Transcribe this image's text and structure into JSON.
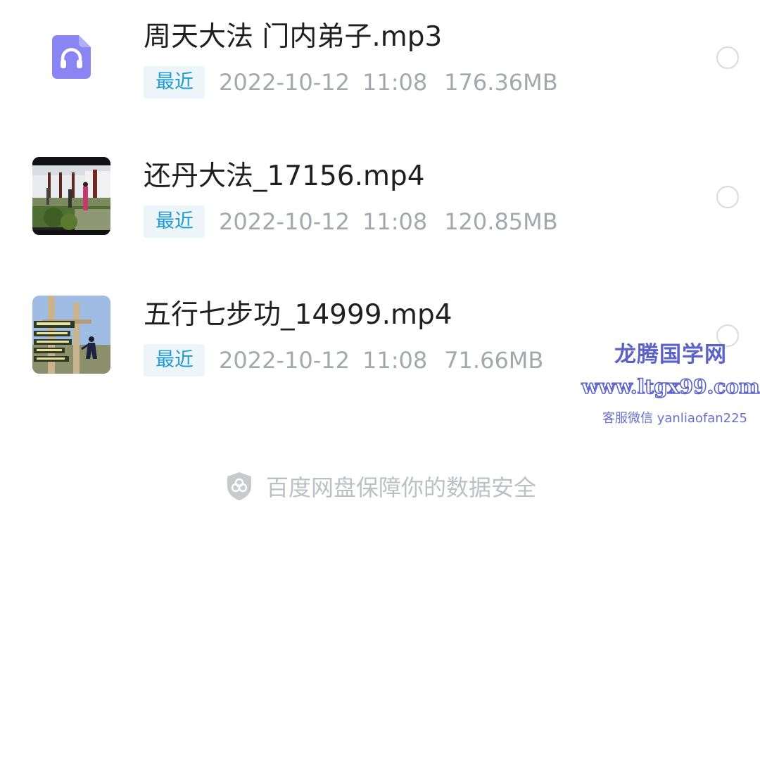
{
  "files": [
    {
      "name": "周天大法 门内弟子.mp3",
      "tag": "最近",
      "date": "2022-10-12",
      "time": "11:08",
      "size": "176.36MB",
      "icon": "audio-file-icon"
    },
    {
      "name": "还丹大法_17156.mp4",
      "tag": "最近",
      "date": "2022-10-12",
      "time": "11:08",
      "size": "120.85MB",
      "icon": "video-thumbnail"
    },
    {
      "name": "五行七步功_14999.mp4",
      "tag": "最近",
      "date": "2022-10-12",
      "time": "11:08",
      "size": "71.66MB",
      "icon": "video-thumbnail"
    }
  ],
  "security_note": {
    "text": "百度网盘保障你的数据安全",
    "icon": "shield-icon"
  },
  "watermark": {
    "title": "龙腾国学网",
    "site": "www.ltgx99.com",
    "contact": "客服微信 yanliaofan225"
  },
  "colors": {
    "tag_text": "#1d9ad6",
    "tag_bg": "#eef5f9",
    "meta_text": "#a4a8ad",
    "audio_icon": "#8b84f3",
    "watermark": "#5b63c9"
  }
}
